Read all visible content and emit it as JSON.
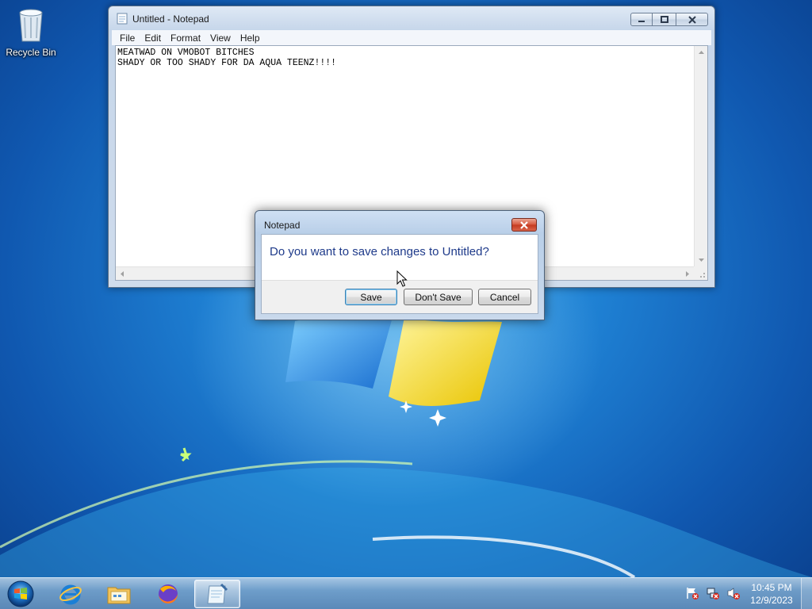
{
  "desktop": {
    "icons": [
      {
        "label": "Recycle Bin",
        "icon": "recycle-bin-icon"
      }
    ]
  },
  "notepad": {
    "title": "Untitled - Notepad",
    "menu": [
      "File",
      "Edit",
      "Format",
      "View",
      "Help"
    ],
    "content": "MEATWAD ON VMOBOT BITCHES\nSHADY OR TOO SHADY FOR DA AQUA TEENZ!!!!"
  },
  "dialog": {
    "title": "Notepad",
    "message": "Do you want to save changes to Untitled?",
    "buttons": {
      "save": "Save",
      "dont_save": "Don't Save",
      "cancel": "Cancel"
    }
  },
  "taskbar": {
    "pinned": [
      {
        "name": "internet-explorer",
        "icon": "internet-explorer-icon"
      },
      {
        "name": "windows-explorer",
        "icon": "folder-icon"
      },
      {
        "name": "firefox",
        "icon": "firefox-icon"
      },
      {
        "name": "notepad",
        "icon": "notepad-icon",
        "active": true
      }
    ],
    "tray": [
      "action-center-flag-icon",
      "network-icon",
      "volume-muted-icon"
    ],
    "clock": {
      "time": "10:45 PM",
      "date": "12/9/2023"
    }
  },
  "colors": {
    "desktop_blue": "#1e7fd2",
    "dialog_message": "#1e3a8a",
    "close_red": "#c43a1f"
  }
}
